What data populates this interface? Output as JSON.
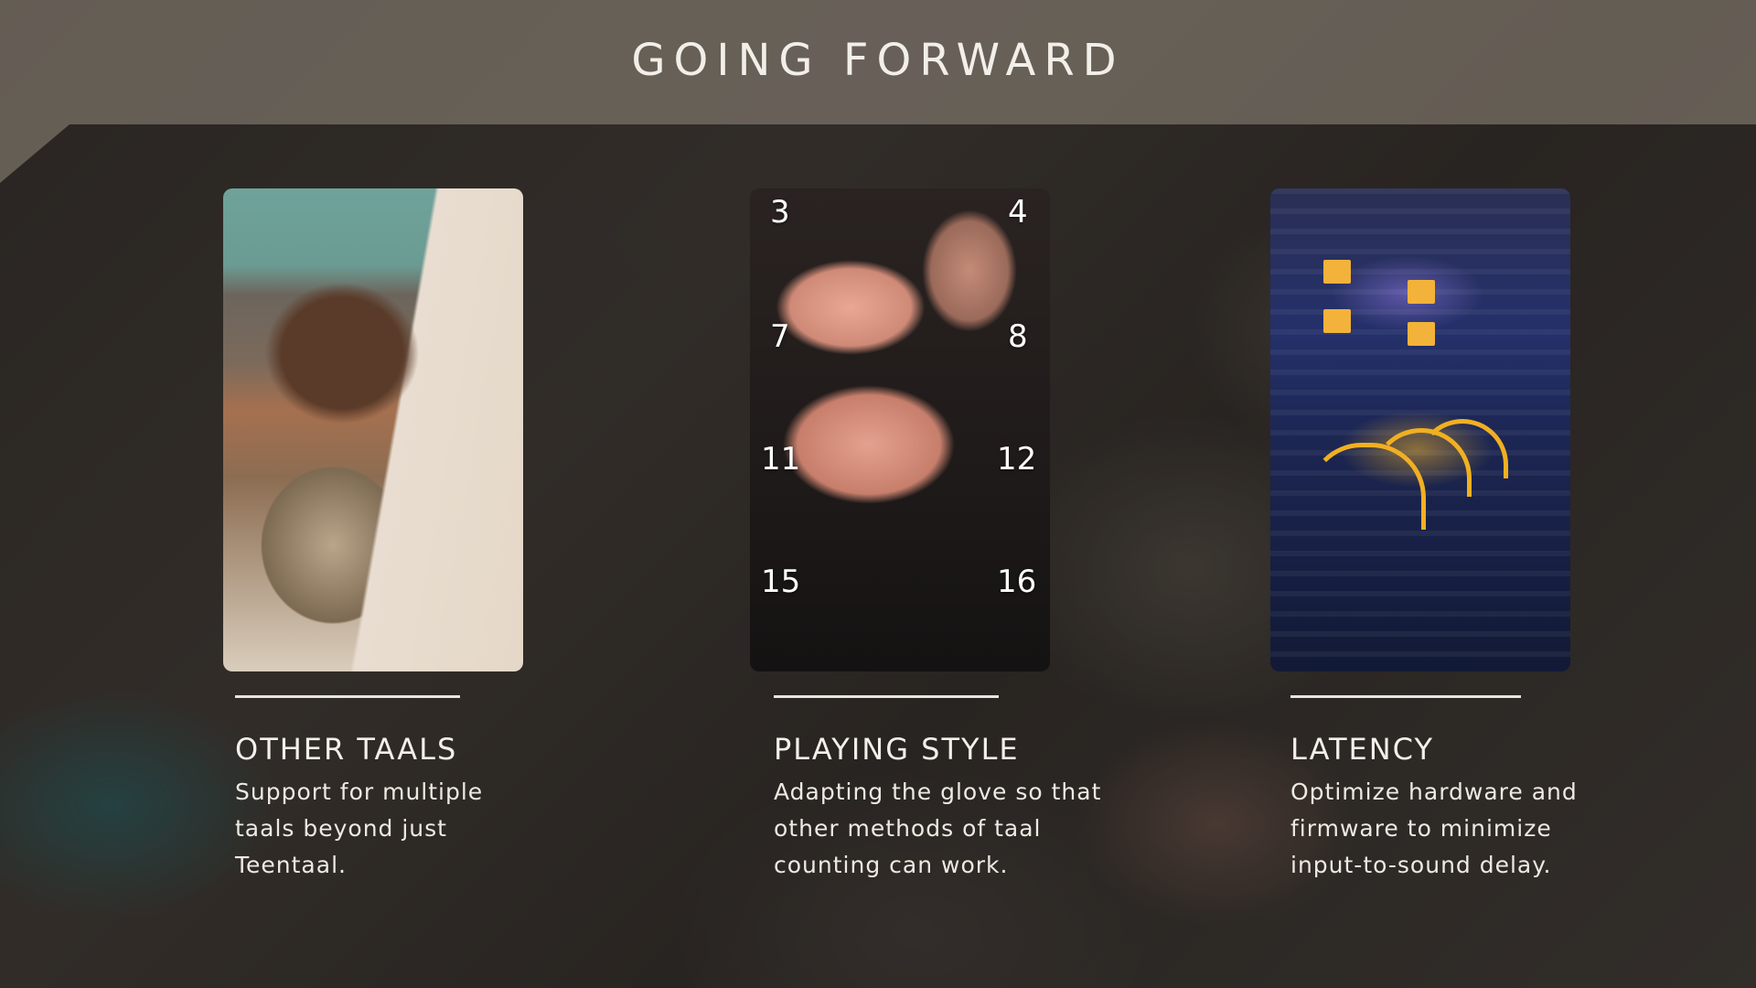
{
  "slide": {
    "title": "GOING FORWARD"
  },
  "cards": [
    {
      "title": "OTHER TAALS",
      "description": "Support for multiple\ntaals beyond just\nTeentaal.",
      "image": "tabla-drum-hand-photo"
    },
    {
      "title": "PLAYING STYLE",
      "description": "Adapting the glove so that\nother methods of taal\ncounting can work.",
      "image": "hand-counting-photo",
      "overlay_numbers": [
        "3",
        "4",
        "7",
        "8",
        "11",
        "12",
        "15",
        "16"
      ]
    },
    {
      "title": "LATENCY",
      "description": "Optimize hardware and\nfirmware to minimize\ninput-to-sound delay.",
      "image": "audio-rack-cables-photo"
    }
  ]
}
